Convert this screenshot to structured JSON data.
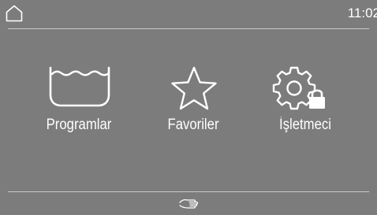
{
  "status_bar": {
    "home_icon": "home-icon",
    "clock": "11:02"
  },
  "main_menu": {
    "tiles": [
      {
        "label": "Programlar",
        "icon": "washtub-icon"
      },
      {
        "label": "Favoriler",
        "icon": "star-icon"
      },
      {
        "label": "İşletmeci",
        "icon": "gear-lock-icon"
      }
    ]
  },
  "bottom_bar": {
    "icon": "hand-point-icon"
  },
  "colors": {
    "background": "#7c7c7c",
    "foreground": "#ffffff",
    "divider": "#c9c9c9"
  }
}
